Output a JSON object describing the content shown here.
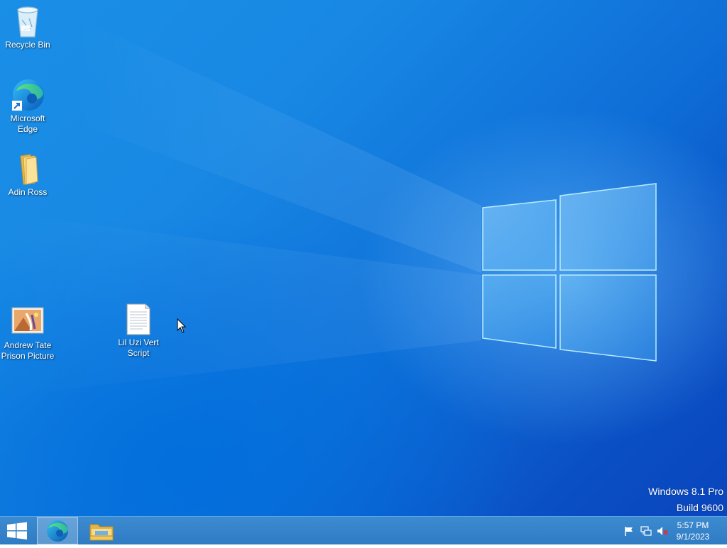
{
  "desktop": {
    "icons": [
      {
        "label": "Recycle Bin",
        "icon": "recycle-bin-icon"
      },
      {
        "label": "Microsoft Edge",
        "icon": "edge-icon"
      },
      {
        "label": "Adin Ross",
        "icon": "folder-icon"
      },
      {
        "label": "Andrew Tate Prison Picture",
        "icon": "image-file-icon"
      },
      {
        "label": "Lil Uzi Vert Script",
        "icon": "text-file-icon"
      }
    ]
  },
  "watermark": {
    "line1": "Windows 8.1 Pro",
    "line2": "Build 9600"
  },
  "taskbar": {
    "start": "windows-logo-icon",
    "pinned": [
      {
        "name": "Microsoft Edge",
        "icon": "edge-icon",
        "active": true
      },
      {
        "name": "File Explorer",
        "icon": "file-explorer-icon",
        "active": false
      }
    ],
    "tray": {
      "icons": [
        "action-center-flag-icon",
        "network-icon",
        "volume-muted-icon"
      ],
      "time": "5:57 PM",
      "date": "9/1/2023"
    }
  },
  "colors": {
    "wallpaper": "#1a8fe6",
    "taskbar": "#3484c8"
  }
}
